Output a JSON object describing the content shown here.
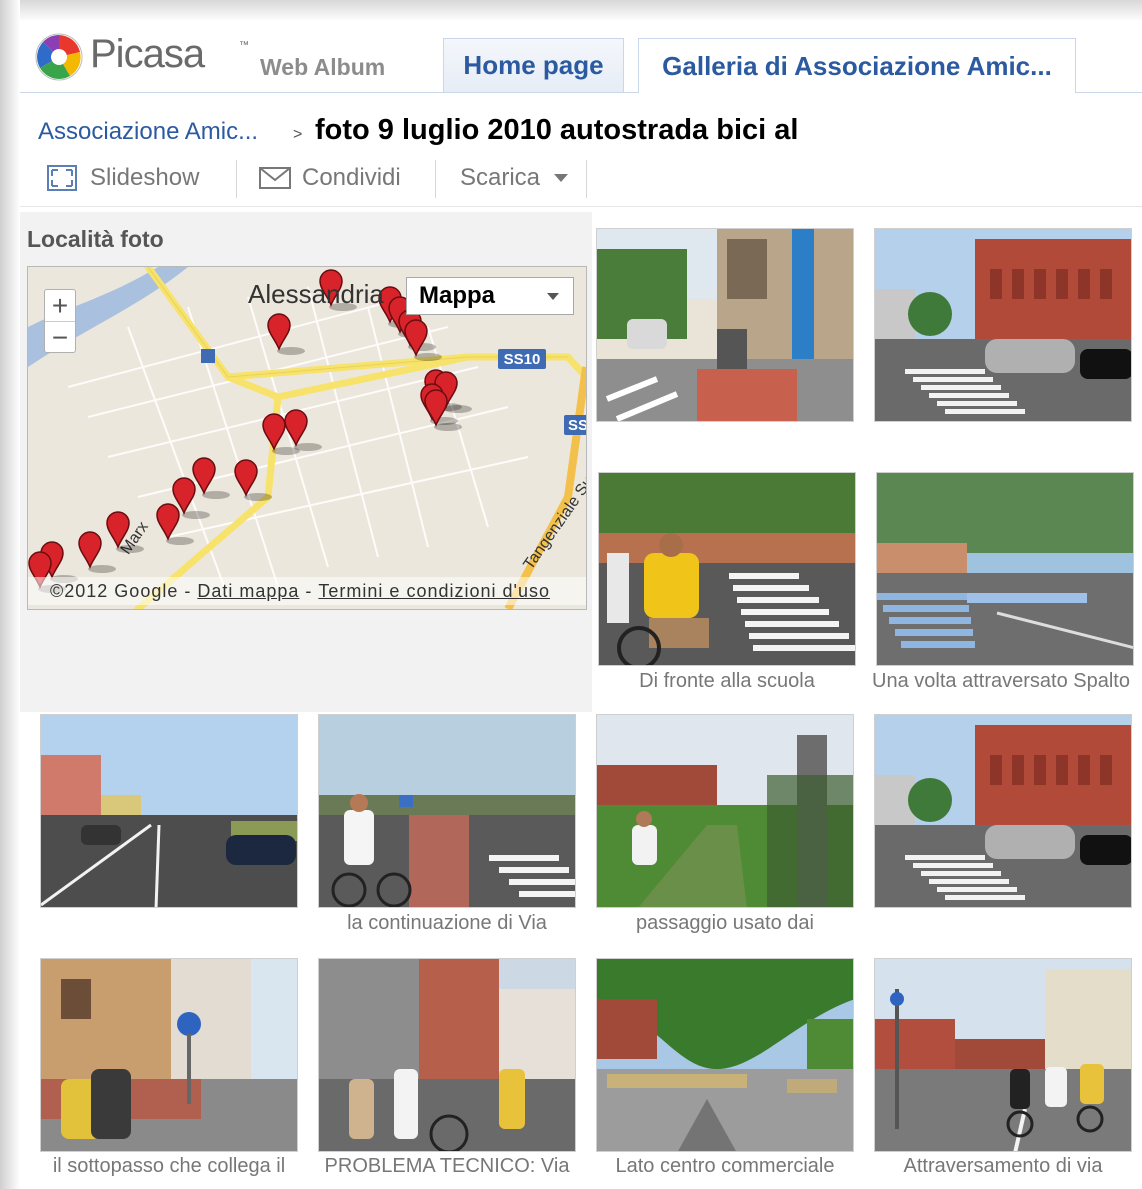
{
  "header": {
    "logo_text": "Picasa",
    "logo_tm": "™",
    "logo_sub": "Web Album",
    "tabs": [
      {
        "label": "Home page"
      },
      {
        "label": "Galleria di Associazione Amic..."
      }
    ]
  },
  "breadcrumb": {
    "parent": "Associazione Amic...",
    "separator": ">",
    "title": "foto 9 luglio 2010 autostrada bici al"
  },
  "toolbar": {
    "slideshow": "Slideshow",
    "share": "Condividi",
    "download": "Scarica"
  },
  "map": {
    "heading": "Località foto",
    "city_label": "Alessandria",
    "map_type": "Mappa",
    "road_labels": [
      "SS10",
      "SS",
      "Marx",
      "Tangenziale Sudest"
    ],
    "footer_copyright": "©2012 Google",
    "footer_sep": "-",
    "footer_data": "Dati mappa",
    "footer_terms": "Termini e condizioni d'uso",
    "zoom_in": "+",
    "zoom_out": "−"
  },
  "photos": [
    {
      "caption": "",
      "scene": "street-bike"
    },
    {
      "caption": "",
      "scene": "church"
    },
    {
      "caption": "Di fronte alla scuola",
      "scene": "crosswalk-rider"
    },
    {
      "caption": "Una volta attraversato Spalto",
      "scene": "crosswalk-blue"
    },
    {
      "caption": "",
      "scene": "road"
    },
    {
      "caption": "la continuazione di Via",
      "scene": "cyclists-road"
    },
    {
      "caption": "passaggio usato dai",
      "scene": "path"
    },
    {
      "caption": "",
      "scene": "church"
    },
    {
      "caption": "il sottopasso che collega il",
      "scene": "underpass"
    },
    {
      "caption": "PROBLEMA TECNICO: Via",
      "scene": "street-group"
    },
    {
      "caption": "Lato centro commerciale",
      "scene": "tree-plaza"
    },
    {
      "caption": "Attraversamento di via",
      "scene": "crossing"
    }
  ],
  "colors": {
    "link": "#2c5aa0",
    "pin": "#d8232a",
    "road_major": "#f7e36b"
  }
}
